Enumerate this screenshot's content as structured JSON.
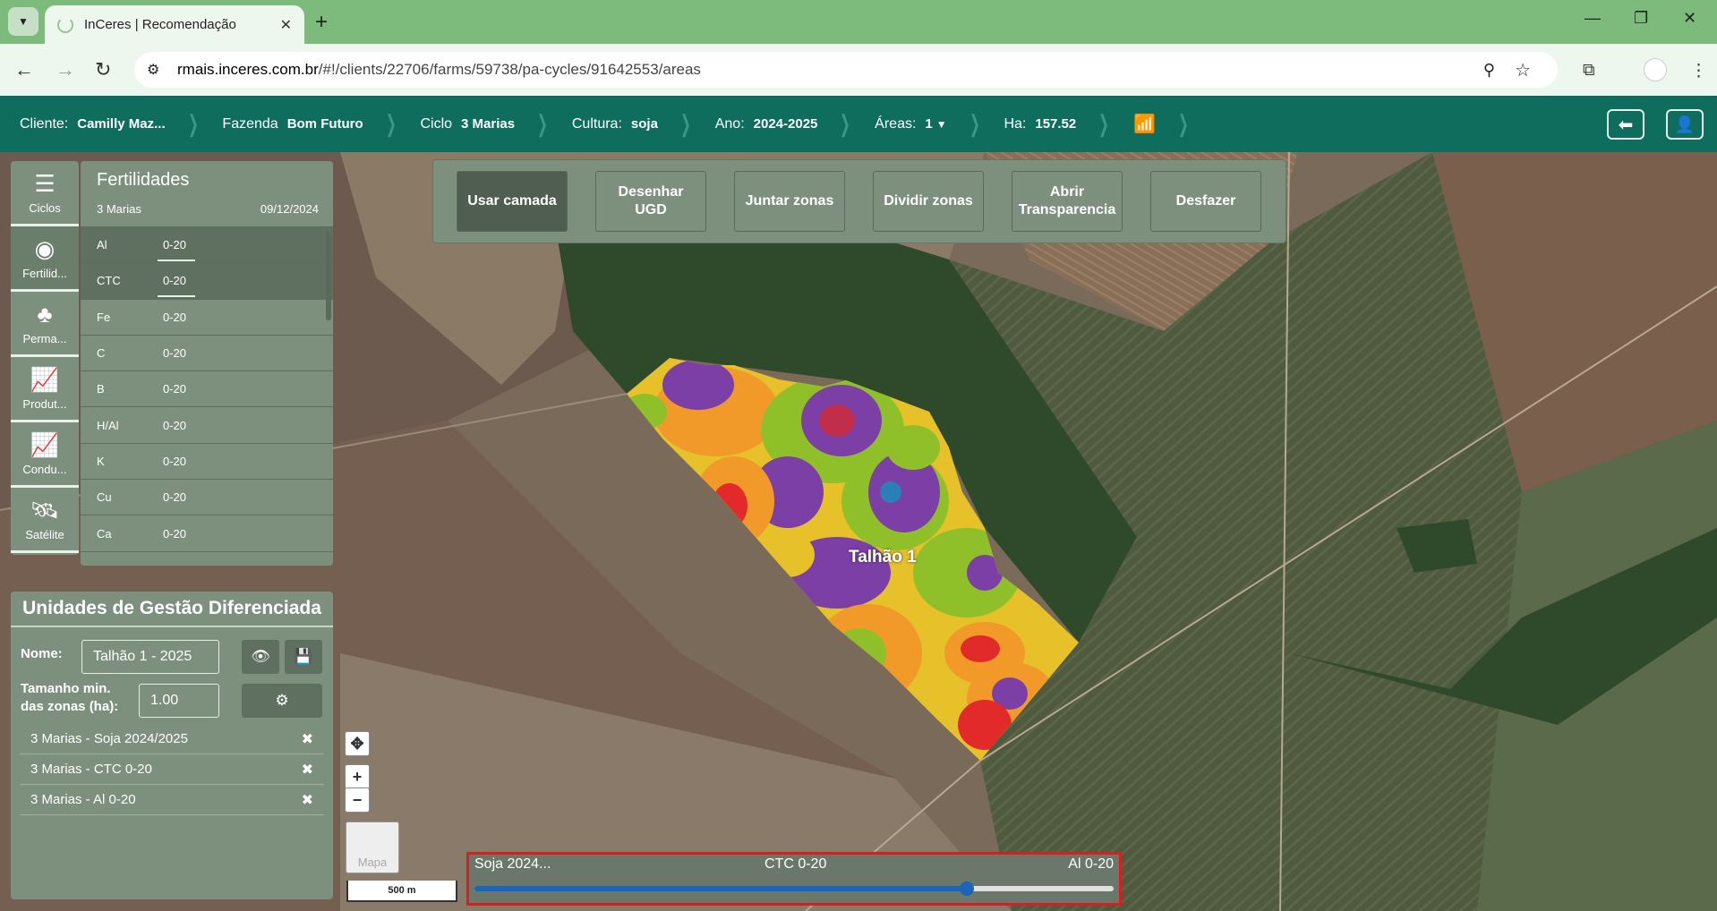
{
  "browser": {
    "tab_title": "InCeres | Recomendação",
    "url_host": "rmais.inceres.com.br",
    "url_path": "/#!/clients/22706/farms/59738/pa-cycles/91642553/areas"
  },
  "header": {
    "client_label": "Cliente:",
    "client_value": "Camilly Maz...",
    "farm_label": "Fazenda",
    "farm_value": "Bom Futuro",
    "cycle_label": "Ciclo",
    "cycle_value": "3 Marias",
    "crop_label": "Cultura:",
    "crop_value": "soja",
    "year_label": "Ano:",
    "year_value": "2024-2025",
    "areas_label": "Áreas:",
    "areas_value": "1",
    "ha_label": "Ha:",
    "ha_value": "157.52"
  },
  "rail": [
    {
      "label": "Ciclos",
      "icon": "list-icon"
    },
    {
      "label": "Fertilid...",
      "icon": "soil-sample-icon"
    },
    {
      "label": "Perma...",
      "icon": "plants-icon"
    },
    {
      "label": "Produt...",
      "icon": "line-chart-icon"
    },
    {
      "label": "Condu...",
      "icon": "line-chart-icon"
    },
    {
      "label": "Satélite",
      "icon": "satellite-icon"
    }
  ],
  "fertility": {
    "title": "Fertilidades",
    "cycle": "3 Marias",
    "date": "09/12/2024",
    "rows": [
      {
        "name": "Al",
        "depth": "0-20"
      },
      {
        "name": "CTC",
        "depth": "0-20"
      },
      {
        "name": "Fe",
        "depth": "0-20"
      },
      {
        "name": "C",
        "depth": "0-20"
      },
      {
        "name": "B",
        "depth": "0-20"
      },
      {
        "name": "H/Al",
        "depth": "0-20"
      },
      {
        "name": "K",
        "depth": "0-20"
      },
      {
        "name": "Cu",
        "depth": "0-20"
      },
      {
        "name": "Ca",
        "depth": "0-20"
      }
    ]
  },
  "ugd": {
    "title": "Unidades de Gestão Diferenciada",
    "name_label": "Nome:",
    "name_value": "Talhão 1 - 2025",
    "min_size_label_1": "Tamanho min.",
    "min_size_label_2": "das zonas (ha):",
    "min_size_value": "1.00",
    "layers": [
      "3 Marias - Soja 2024/2025",
      "3 Marias - CTC 0-20",
      "3 Marias - Al 0-20"
    ]
  },
  "toolbar": {
    "use_layer": "Usar camada",
    "draw_ugd_1": "Desenhar",
    "draw_ugd_2": "UGD",
    "merge": "Juntar zonas",
    "split": "Dividir zonas",
    "transp_1": "Abrir",
    "transp_2": "Transparencia",
    "undo": "Desfazer"
  },
  "map": {
    "field_label": "Talhão 1",
    "basemap_label": "Mapa",
    "scale_label": "500 m"
  },
  "timeline": {
    "left": "Soja 2024...",
    "middle": "CTC 0-20",
    "right": "Al 0-20",
    "position_pct": 77
  }
}
